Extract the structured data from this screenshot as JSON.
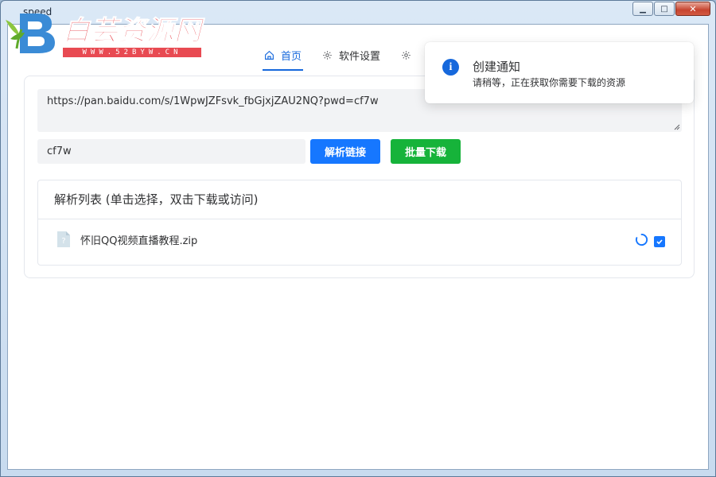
{
  "window": {
    "title": "speed",
    "minimize_glyph": "▁",
    "maximize_glyph": "□",
    "close_glyph": "✕"
  },
  "watermark": {
    "logo_text": "白芸资源网",
    "url_text": "WWW.52BYW.CN"
  },
  "nav": {
    "items": [
      {
        "label": "首页",
        "icon": "home-icon",
        "active": true
      },
      {
        "label": "软件设置",
        "icon": "gear-icon",
        "active": false
      },
      {
        "label": "",
        "icon": "gear-icon",
        "active": false
      }
    ]
  },
  "form": {
    "share_url": "https://pan.baidu.com/s/1WpwJZFsvk_fbGjxjZAU2NQ?pwd=cf7w",
    "password": "cf7w",
    "parse_button": "解析链接",
    "batch_download_button": "批量下载"
  },
  "list": {
    "header": "解析列表 (单击选择，双击下载或访问)",
    "items": [
      {
        "name": "怀旧QQ视频直播教程.zip",
        "icon": "unknown-file-icon",
        "loading": true,
        "checked": true
      }
    ]
  },
  "notification": {
    "title": "创建通知",
    "message": "请稍等，正在获取你需要下载的资源",
    "icon_glyph": "i"
  },
  "colors": {
    "primary": "#1677ff",
    "success": "#16b33a",
    "watermark_red": "#e84a52"
  }
}
